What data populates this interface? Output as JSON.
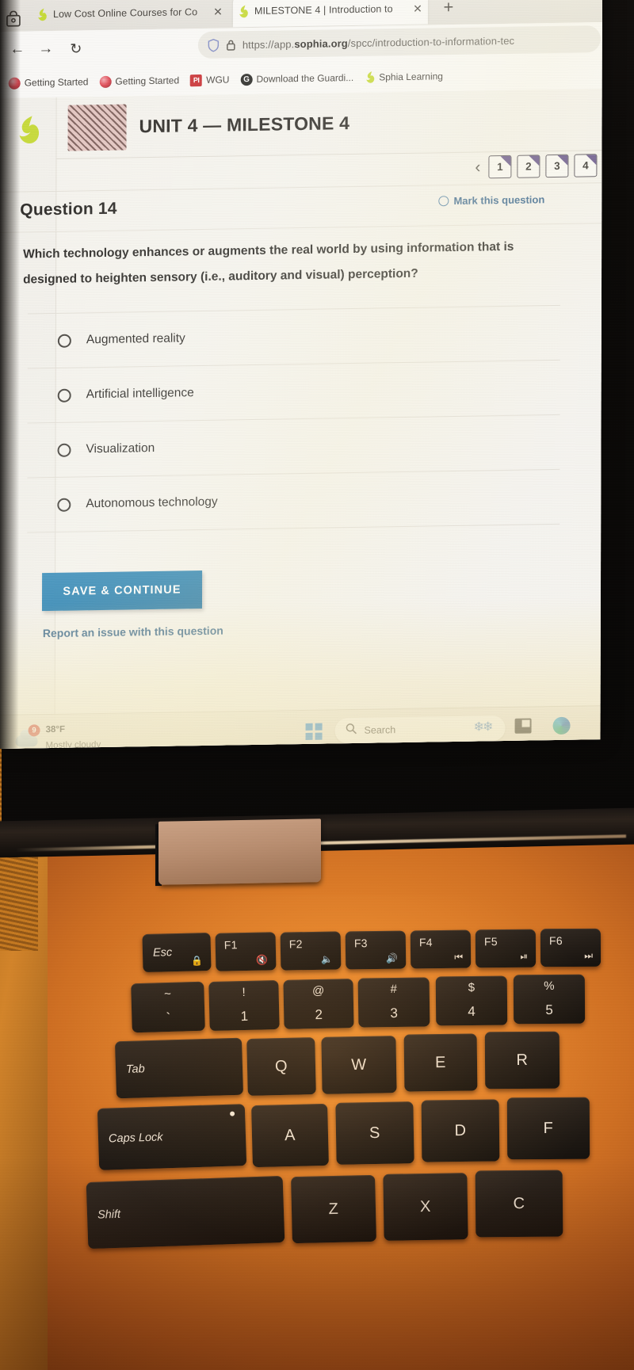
{
  "browser": {
    "vault_icon": "vault-icon",
    "tabs": [
      {
        "title": "Low Cost Online Courses for Co",
        "favicon": "sophia-flame-icon",
        "active": false,
        "close": "✕"
      },
      {
        "title": "MILESTONE 4 | Introduction to",
        "favicon": "sophia-flame-icon",
        "active": true,
        "close": "✕"
      }
    ],
    "new_tab_label": "+",
    "nav": {
      "back": "←",
      "forward": "→",
      "reload": "↻"
    },
    "omnibox": {
      "url_prefix": "https://app.",
      "url_domain": "sophia.org",
      "url_path": "/spcc/introduction-to-information-tec",
      "shield_icon": "shield-icon",
      "lock_icon": "lock-icon"
    },
    "bookmarks": [
      {
        "label": "Getting Started",
        "icon": "firefox-icon"
      },
      {
        "label": "Getting Started",
        "icon": "firefox-icon"
      },
      {
        "label": "WGU",
        "icon": "pi-icon",
        "icon_text": "PI"
      },
      {
        "label": "Download the Guardi...",
        "icon": "guardian-icon",
        "icon_text": "G"
      },
      {
        "label": "Sphia Learning",
        "icon": "sophia-flame-icon"
      }
    ]
  },
  "course": {
    "logo": "sophia-logo",
    "thumbnail": "course-thumbnail",
    "title": "UNIT 4 — MILESTONE 4"
  },
  "pager": {
    "prev_icon": "‹",
    "pages": [
      "1",
      "2",
      "3",
      "4"
    ]
  },
  "question": {
    "heading": "Question 14",
    "mark_label": "Mark this question",
    "text_line1": "Which technology enhances or augments the real world by using information",
    "text_line2": "that is designed to heighten sensory (i.e., auditory and visual) perception?",
    "options": [
      {
        "label": "Augmented reality",
        "selected": false
      },
      {
        "label": "Artificial intelligence",
        "selected": false
      },
      {
        "label": "Visualization",
        "selected": false
      },
      {
        "label": "Autonomous technology",
        "selected": false
      }
    ],
    "save_label": "SAVE & CONTINUE",
    "report_label": "Report an issue with this question"
  },
  "taskbar": {
    "weather": {
      "badge": "9",
      "temperature": "38°F",
      "condition": "Mostly cloudy",
      "icon": "cloud-icon"
    },
    "start_icon": "windows-logo-icon",
    "search_placeholder": "Search",
    "search_icon": "search-icon",
    "tray": [
      {
        "icon": "snowflake-icon"
      },
      {
        "icon": "file-explorer-icon"
      },
      {
        "icon": "edge-browser-icon"
      }
    ]
  },
  "keyboard": {
    "function_row": [
      {
        "main": "Esc",
        "sub": "🔒",
        "word": true
      },
      {
        "main": "F1",
        "sub": "🔇"
      },
      {
        "main": "F2",
        "sub": "🔈"
      },
      {
        "main": "F3",
        "sub": "🔊"
      },
      {
        "main": "F4",
        "sub": "⏮"
      },
      {
        "main": "F5",
        "sub": "⏯"
      },
      {
        "main": "F6",
        "sub": "⏭"
      }
    ],
    "number_row": [
      {
        "top": "~",
        "bottom": "`"
      },
      {
        "top": "!",
        "bottom": "1"
      },
      {
        "top": "@",
        "bottom": "2"
      },
      {
        "top": "#",
        "bottom": "3"
      },
      {
        "top": "$",
        "bottom": "4"
      },
      {
        "top": "%",
        "bottom": "5"
      }
    ],
    "row_q": [
      {
        "label": "Tab",
        "wide": true
      },
      {
        "label": "Q"
      },
      {
        "label": "W"
      },
      {
        "label": "E"
      },
      {
        "label": "R"
      }
    ],
    "row_a": [
      {
        "label": "Caps Lock",
        "wide": true,
        "indicator": true
      },
      {
        "label": "A"
      },
      {
        "label": "S"
      },
      {
        "label": "D"
      },
      {
        "label": "F"
      }
    ],
    "row_z": [
      {
        "label": "Shift",
        "wide": true
      },
      {
        "label": "Z"
      },
      {
        "label": "X"
      },
      {
        "label": "C"
      }
    ]
  },
  "colors": {
    "accent_blue": "#1f7cb0",
    "link_blue": "#2b5d86",
    "pager_flag": "#5d4a86",
    "desk_orange": "#e5832a"
  }
}
